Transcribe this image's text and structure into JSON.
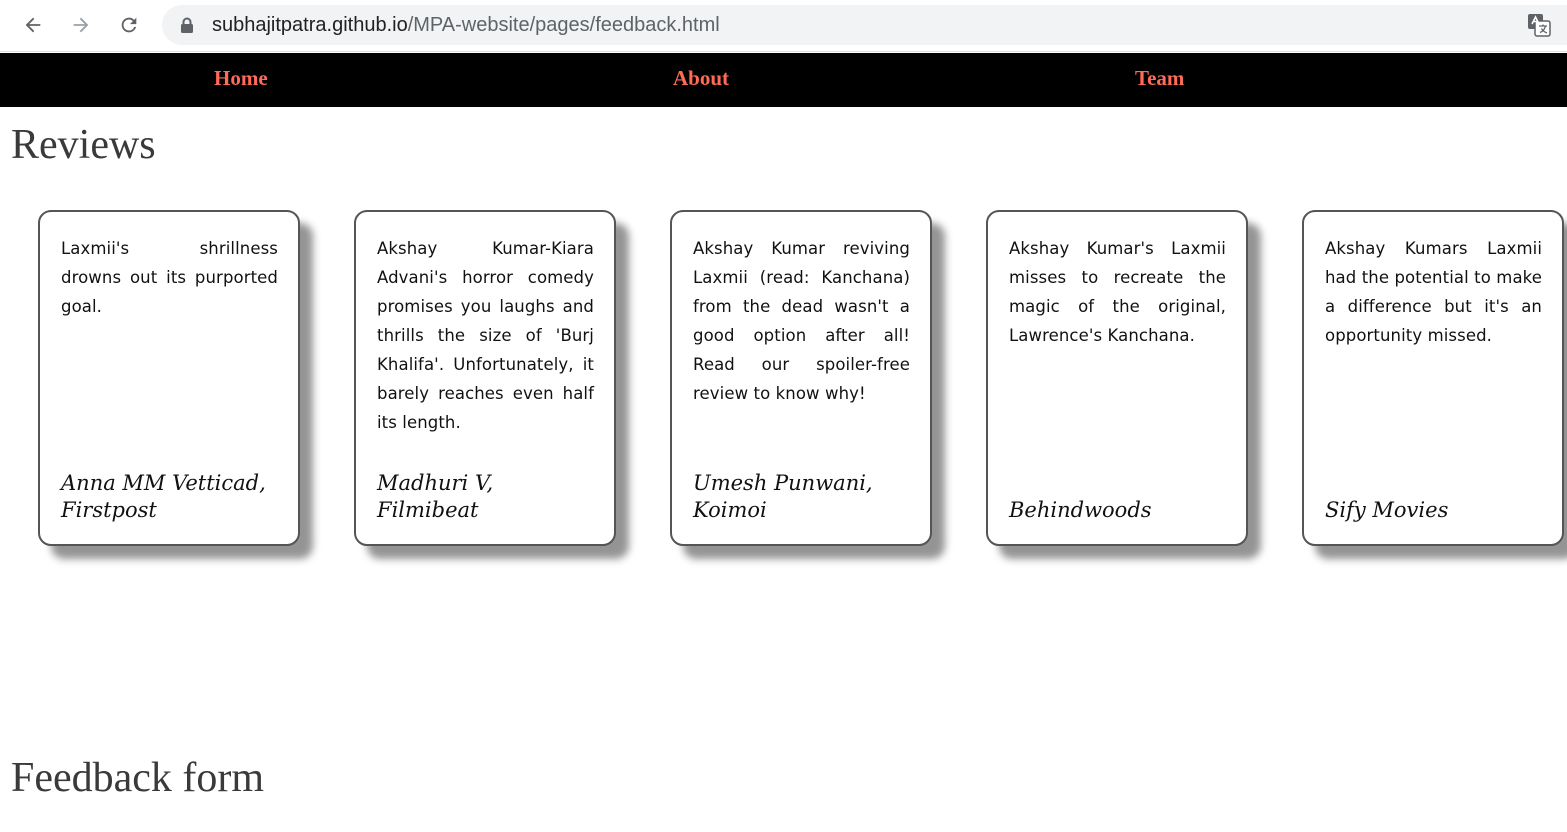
{
  "browser": {
    "url_host": "subhajitpatra.github.io",
    "url_path": "/MPA-website/pages/feedback.html",
    "icons": [
      "back-arrow-icon",
      "forward-arrow-icon",
      "reload-icon",
      "lock-icon",
      "translate-icon"
    ]
  },
  "nav": {
    "home": "Home",
    "about": "About",
    "team": "Team",
    "link_color": "#ff6b57",
    "background": "#000000"
  },
  "reviews": {
    "title": "Reviews",
    "cards": [
      {
        "text": "Laxmii's shrillness drowns out its purported goal.",
        "author": "Anna MM Vetticad, Firstpost"
      },
      {
        "text": "Akshay Kumar-Kiara Advani's horror comedy promises you laughs and thrills the size of 'Burj Khalifa'. Unfortunately, it barely reaches even half its length.",
        "author": "Madhuri V, Filmibeat"
      },
      {
        "text": "Akshay Kumar reviving Laxmii (read: Kanchana) from the dead wasn't a good option after all! Read our spoiler-free review to know why!",
        "author": "Umesh Punwani, Koimoi"
      },
      {
        "text": "Akshay Kumar's Laxmii misses to recreate the magic of the original, Lawrence's Kanchana.",
        "author": "Behindwoods"
      },
      {
        "text": "Akshay Kumars Laxmii had the potential to make a difference but it's an opportunity missed.",
        "author": "Sify Movies"
      }
    ]
  },
  "feedback": {
    "title": "Feedback form"
  }
}
